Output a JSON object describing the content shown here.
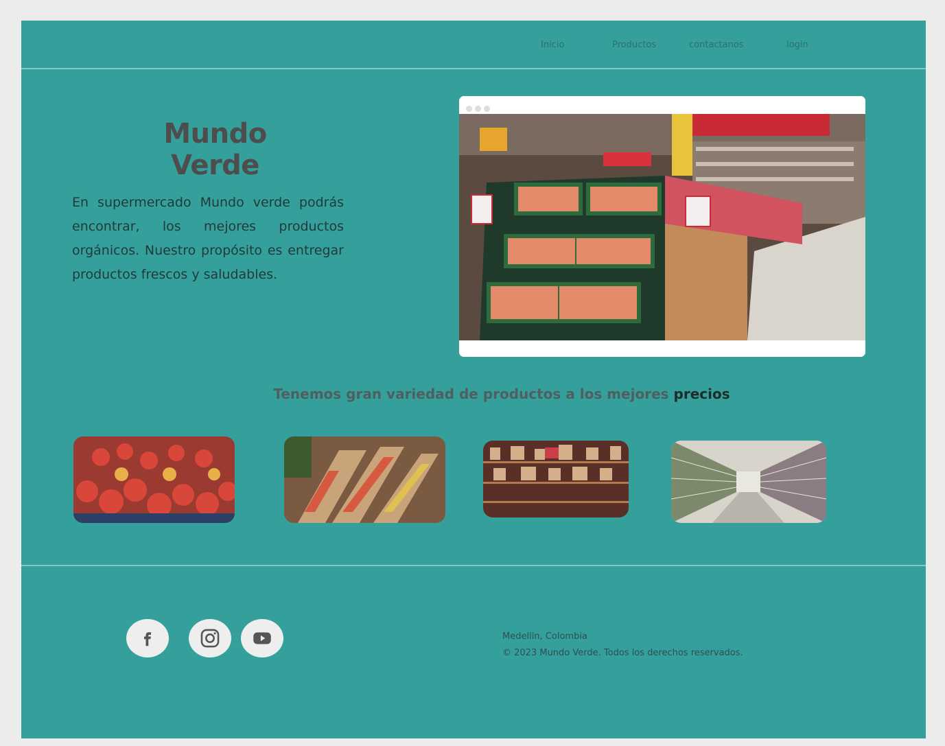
{
  "nav": {
    "items": [
      {
        "label": "Inicio"
      },
      {
        "label": "Productos"
      },
      {
        "label": "contactanos"
      },
      {
        "label": "login"
      }
    ]
  },
  "hero": {
    "title": "Mundo Verde",
    "description": "En supermercado Mundo verde podrás encontrar, los mejores productos orgánicos. Nuestro propósito es entregar productos frescos y saludables."
  },
  "section": {
    "subtitle_main": "Tenemos gran variedad de productos a los mejores",
    "subtitle_emphasis": "precios"
  },
  "footer": {
    "location": "Medellin, Colombia",
    "copyright": "© 2023 Mundo Verde.  Todos los derechos reservados.",
    "social": [
      {
        "icon": "facebook-icon"
      },
      {
        "icon": "instagram-icon"
      },
      {
        "icon": "youtube-icon"
      }
    ]
  },
  "colors": {
    "background": "#35a09b",
    "frame": "#ececec",
    "divider": "#7fcbc7",
    "title": "#4d4d4d",
    "icon_bg": "#eeeeee"
  }
}
